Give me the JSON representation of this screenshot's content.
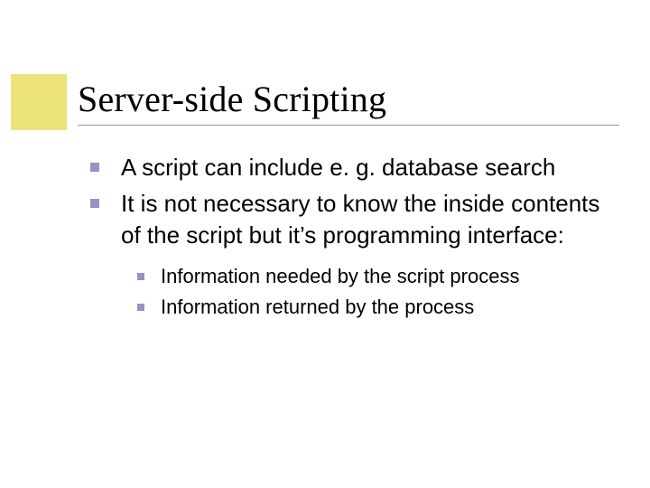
{
  "slide": {
    "title": "Server-side Scripting",
    "bullets": [
      {
        "text": "A script can include e. g. database search"
      },
      {
        "text": "It is not necessary to know the inside contents of the script but it’s programming interface:"
      }
    ],
    "sub_bullets": [
      {
        "text": "Information needed by the script process"
      },
      {
        "text": "Information returned by the process"
      }
    ]
  }
}
